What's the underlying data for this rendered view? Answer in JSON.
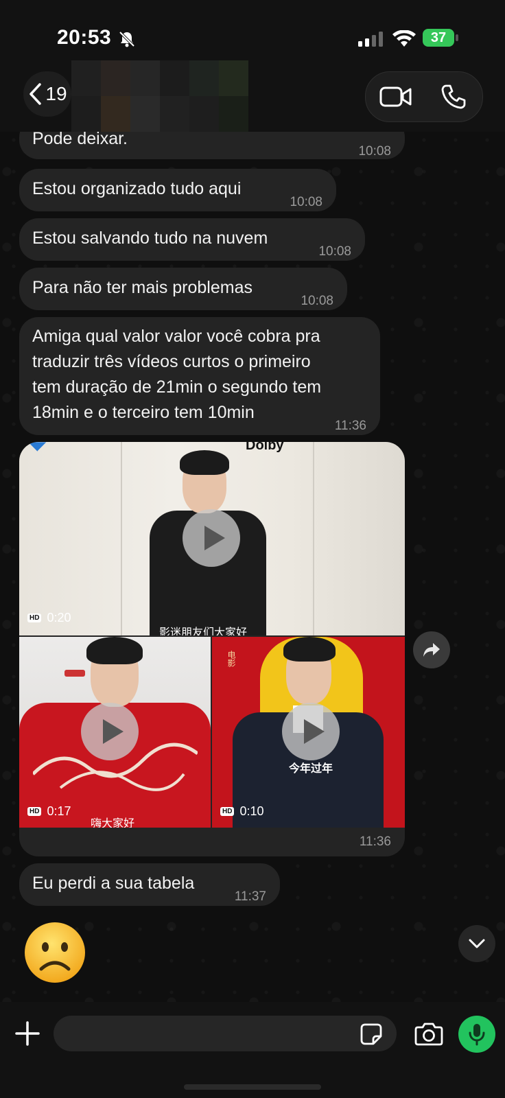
{
  "status_bar": {
    "time": "20:53",
    "battery": "37"
  },
  "header": {
    "back_count": "19"
  },
  "messages": [
    {
      "text": "Pode deixar.",
      "time": "10:08"
    },
    {
      "text": "Estou organizado tudo aqui",
      "time": "10:08"
    },
    {
      "text": "Estou salvando tudo na nuvem",
      "time": "10:08"
    },
    {
      "text": "Para não ter mais problemas",
      "time": "10:08"
    },
    {
      "lines": [
        "Amiga qual valor valor você cobra pra",
        "traduzir três vídeos curtos o primeiro",
        "tem duração de 21min o segundo tem",
        "18min e o terceiro tem 10min"
      ],
      "time": "11:36"
    },
    {
      "text": "Eu perdi a sua tabela",
      "time": "11:37"
    }
  ],
  "media_group": {
    "time": "11:36",
    "videos": [
      {
        "badge": "HD",
        "duration": "0:20",
        "caption": "影迷朋友们大家好",
        "top_text": "Dolby"
      },
      {
        "badge": "HD",
        "duration": "0:17",
        "caption": "嗨大家好"
      },
      {
        "badge": "HD",
        "duration": "0:10",
        "caption": "今年过年"
      }
    ]
  },
  "emoji_message": "☹",
  "input": {
    "placeholder": ""
  },
  "colors": {
    "bubble": "#242424",
    "accent_green": "#22c35e",
    "background": "#0f0f0f"
  },
  "icons": [
    "bell-slash-icon",
    "signal-icon",
    "wifi-icon",
    "battery-icon",
    "chevron-left-icon",
    "video-call-icon",
    "phone-icon",
    "play-icon",
    "forward-icon",
    "chevron-down-icon",
    "plus-icon",
    "sticker-icon",
    "camera-icon",
    "microphone-icon"
  ]
}
